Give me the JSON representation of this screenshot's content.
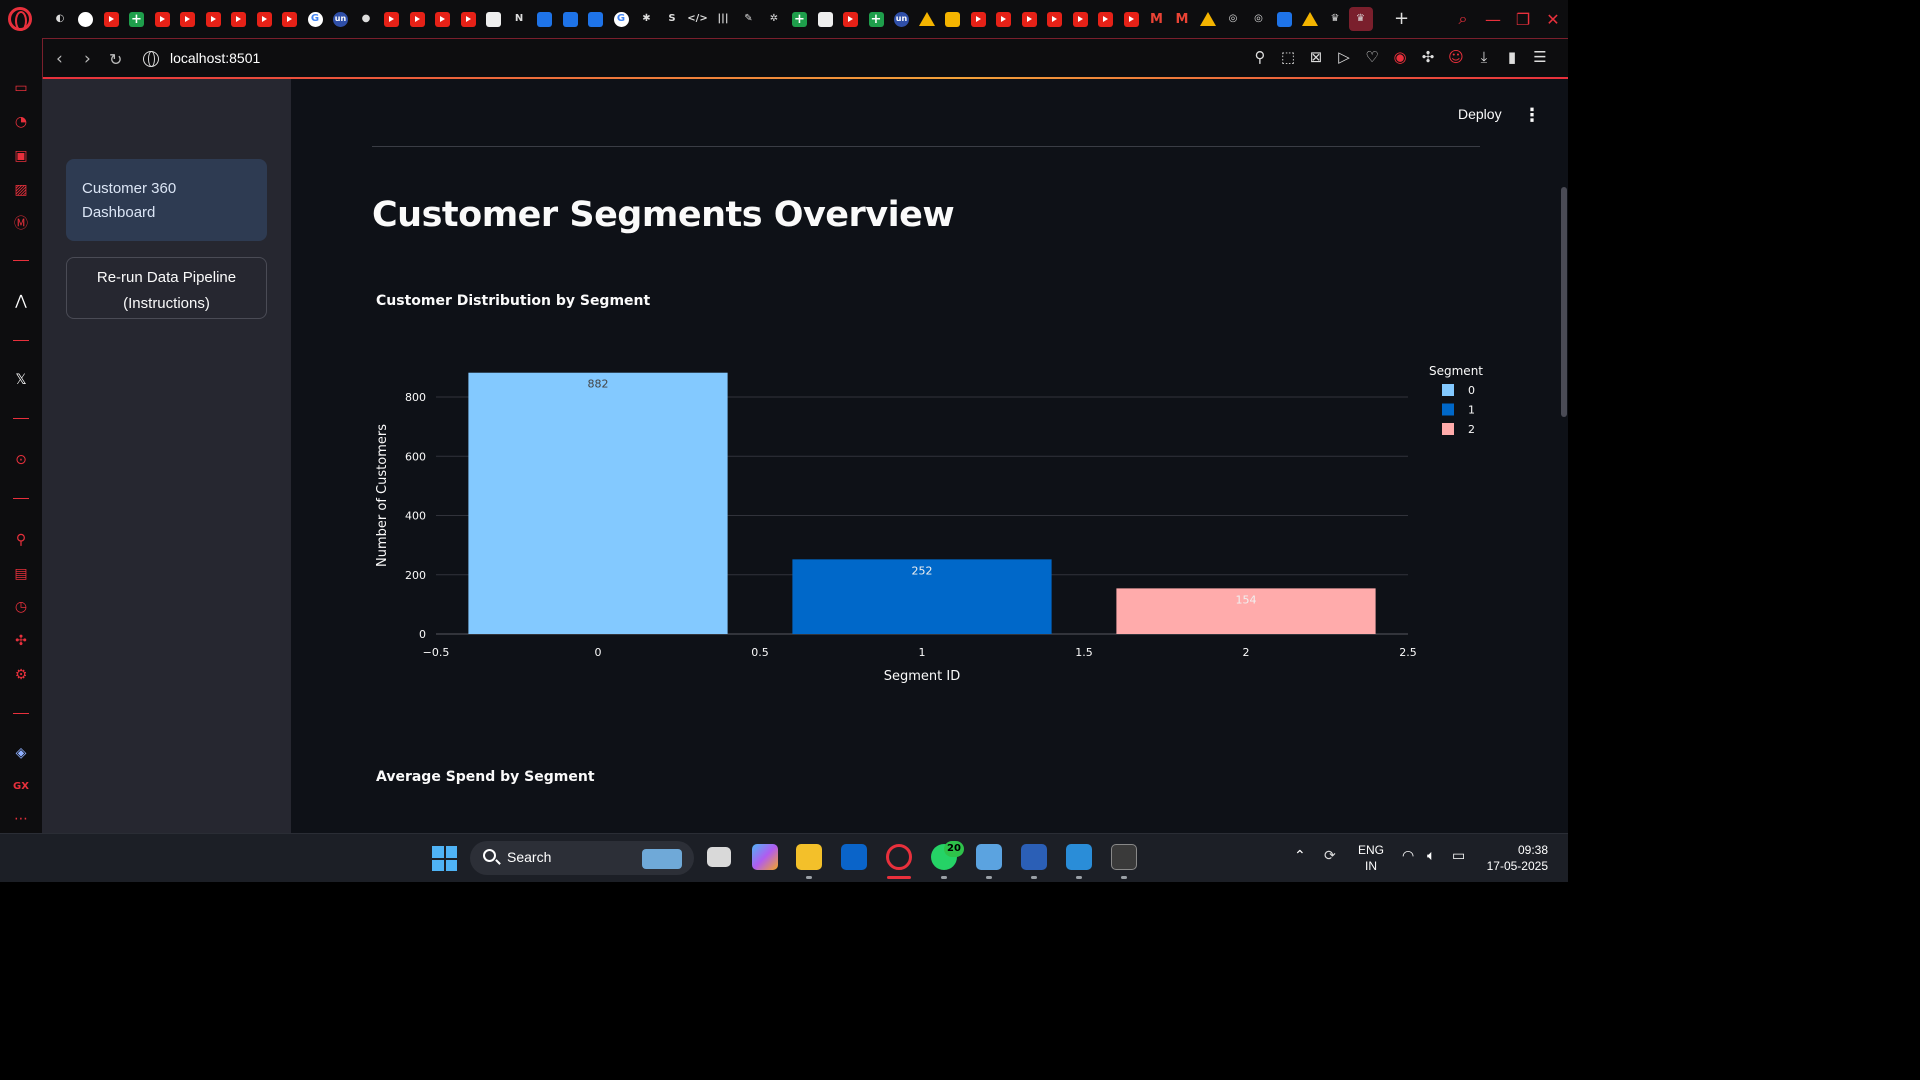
{
  "browser": {
    "url": "localhost:8501",
    "tab_icons": [
      "opera-gx-icon",
      "whatsapp-icon",
      "youtube-icon",
      "sheets-icon",
      "youtube-icon",
      "youtube-icon",
      "youtube-icon",
      "youtube-icon",
      "youtube-icon",
      "youtube-icon",
      "google-icon",
      "unstop-icon",
      "github-icon",
      "youtube-icon",
      "youtube-icon",
      "youtube-icon",
      "youtube-icon",
      "document-icon",
      "notion-icon",
      "app-icon",
      "app-icon",
      "app-icon",
      "google-icon",
      "slack-icon",
      "skype-icon",
      "code-icon",
      "bars-icon",
      "pen-icon",
      "gear-icon",
      "sheets-icon",
      "document-icon",
      "youtube-icon",
      "sheets-icon",
      "unstop-icon",
      "drive-icon",
      "slides-icon",
      "youtube-icon",
      "youtube-icon",
      "youtube-icon",
      "youtube-icon",
      "youtube-icon",
      "youtube-icon",
      "youtube-icon",
      "gmail-icon",
      "gmail-icon",
      "drive-icon",
      "openai-icon",
      "openai-icon",
      "app-icon",
      "drive-icon",
      "crown-icon",
      "crown-icon"
    ]
  },
  "sidebar": {
    "nav_item_label": "Customer 360 Dashboard",
    "pipeline_button_label": "Re-run Data Pipeline (Instructions)"
  },
  "header": {
    "deploy_label": "Deploy"
  },
  "main": {
    "page_title": "Customer Segments Overview",
    "section1_title": "Customer Distribution by Segment",
    "section2_title": "Average Spend by Segment"
  },
  "chart_data": {
    "type": "bar",
    "x": [
      0,
      1,
      2
    ],
    "values": [
      882,
      252,
      154
    ],
    "colors": [
      "#83c9ff",
      "#0068c9",
      "#ffabab"
    ],
    "xlabel": "Segment ID",
    "ylabel": "Number of Customers",
    "xlim": [
      -0.5,
      2.5
    ],
    "ylim": [
      0,
      882
    ],
    "xticks": [
      "−0.5",
      "0",
      "0.5",
      "1",
      "1.5",
      "2",
      "2.5"
    ],
    "yticks": [
      "0",
      "200",
      "400",
      "600",
      "800"
    ],
    "legend": {
      "title": "Segment",
      "entries": [
        "0",
        "1",
        "2"
      ],
      "placement": "right"
    },
    "grid": true
  },
  "taskbar": {
    "search_label": "Search",
    "whatsapp_badge": "20",
    "language": "ENG",
    "region": "IN",
    "time": "09:38",
    "date": "17-05-2025"
  }
}
